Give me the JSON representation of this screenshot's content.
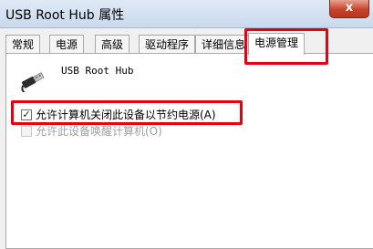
{
  "window": {
    "title": "USB Root Hub 属性",
    "close_label": "x"
  },
  "tabs": [
    {
      "label": "常规"
    },
    {
      "label": "电源"
    },
    {
      "label": "高级"
    },
    {
      "label": "驱动程序"
    },
    {
      "label": "详细信息"
    },
    {
      "label": "电源管理",
      "active": true
    }
  ],
  "device": {
    "name": "USB Root Hub",
    "icon": "usb-plug-icon"
  },
  "options": [
    {
      "label": "允许计算机关闭此设备以节约电源(A)",
      "checked": true,
      "enabled": true
    },
    {
      "label": "允许此设备唤醒计算机(O)",
      "checked": false,
      "enabled": false
    }
  ],
  "highlight_color": "#e8000e"
}
